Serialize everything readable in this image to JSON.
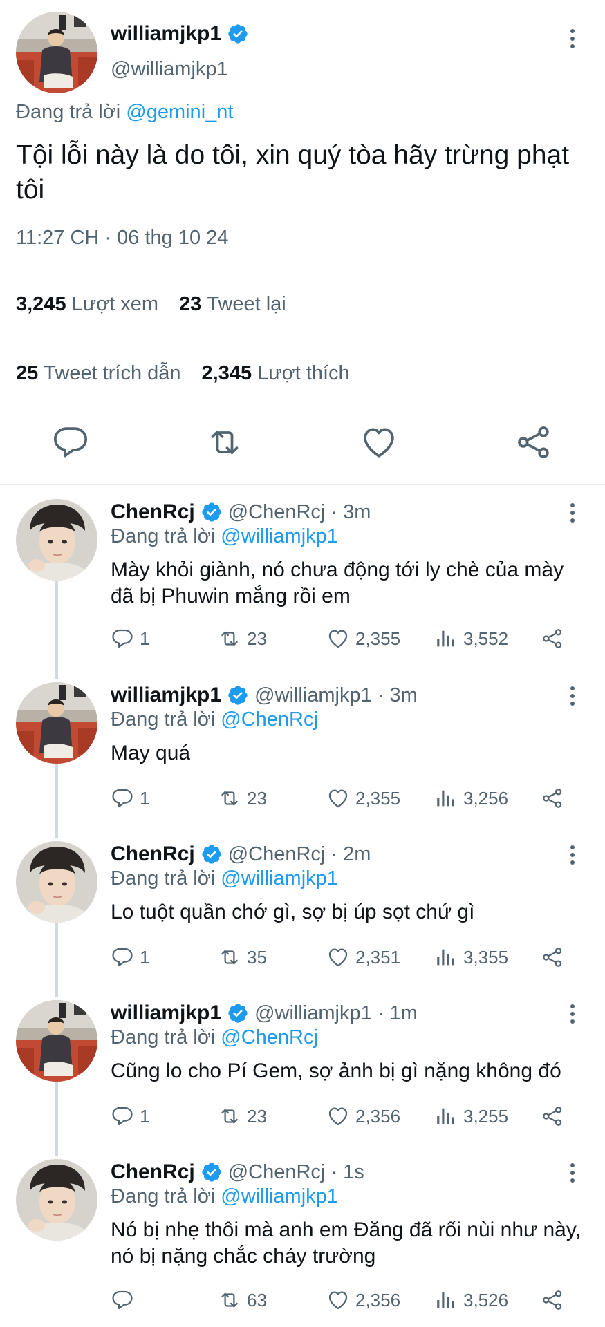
{
  "main_tweet": {
    "display_name": "williamjkp1",
    "handle": "@williamjkp1",
    "reply_prefix": "Đang trả lời",
    "reply_to": "@gemini_nt",
    "text": "Tội lỗi này là do tôi, xin quý tòa hãy trừng phạt tôi",
    "timestamp": "11:27 CH · 06 thg 10 24",
    "views_count": "3,245",
    "views_label": "Lượt xem",
    "retweets_count": "23",
    "retweets_label": "Tweet lại",
    "quotes_count": "25",
    "quotes_label": "Tweet trích dẫn",
    "likes_count": "2,345",
    "likes_label": "Lượt thích"
  },
  "replies": [
    {
      "display_name": "ChenRcj",
      "handle_time": "@ChenRcj · 3m",
      "reply_prefix": "Đang trả lời",
      "reply_to": "@williamjkp1",
      "text": "Mày khỏi giành, nó chưa động tới ly chè của mày đã bị Phuwin mắng rồi em",
      "replies": "1",
      "retweets": "23",
      "likes": "2,355",
      "views": "3,552"
    },
    {
      "display_name": "williamjkp1",
      "handle_time": "@williamjkp1 · 3m",
      "reply_prefix": "Đang trả lời",
      "reply_to": "@ChenRcj",
      "text": "May quá",
      "replies": "1",
      "retweets": "23",
      "likes": "2,355",
      "views": "3,256"
    },
    {
      "display_name": "ChenRcj",
      "handle_time": "@ChenRcj · 2m",
      "reply_prefix": "Đang trả lời",
      "reply_to": "@williamjkp1",
      "text": "Lo tuột quần chớ gì, sợ bị úp sọt chứ gì",
      "replies": "1",
      "retweets": "35",
      "likes": "2,351",
      "views": "3,355"
    },
    {
      "display_name": "williamjkp1",
      "handle_time": "@williamjkp1 · 1m",
      "reply_prefix": "Đang trả lời",
      "reply_to": "@ChenRcj",
      "text": "Cũng lo cho Pí Gem, sợ ảnh bị gì nặng không đó",
      "replies": "1",
      "retweets": "23",
      "likes": "2,356",
      "views": "3,255"
    },
    {
      "display_name": "ChenRcj",
      "handle_time": "@ChenRcj · 1s",
      "reply_prefix": "Đang trả lời",
      "reply_to": "@williamjkp1",
      "text": "Nó bị nhẹ thôi mà anh em Đăng đã rối nùi như này, nó bị nặng chắc cháy trường",
      "replies": "",
      "retweets": "63",
      "likes": "2,356",
      "views": "3,526"
    }
  ],
  "colors": {
    "accent": "#1d9bf0",
    "text_primary": "#0f1419",
    "text_secondary": "#536471",
    "divider": "#dfe3e6"
  },
  "icons": [
    "verified-badge-icon",
    "more-options-icon",
    "reply-icon",
    "retweet-icon",
    "like-icon",
    "views-icon",
    "share-icon"
  ]
}
